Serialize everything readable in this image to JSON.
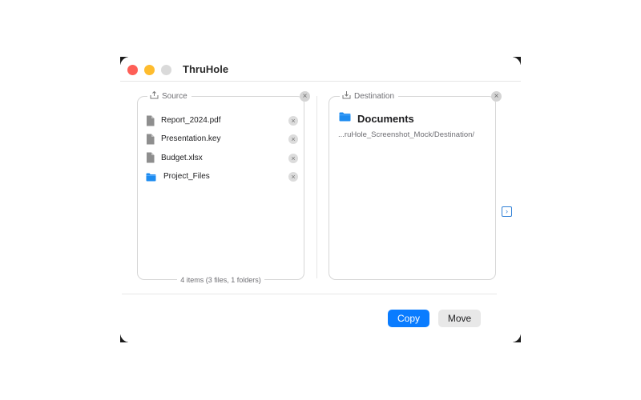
{
  "window": {
    "title": "ThruHole"
  },
  "source": {
    "label": "Source",
    "items": [
      {
        "name": "Report_2024.pdf",
        "kind": "file",
        "icon": "document-icon"
      },
      {
        "name": "Presentation.key",
        "kind": "file",
        "icon": "document-icon"
      },
      {
        "name": "Budget.xlsx",
        "kind": "file",
        "icon": "document-icon"
      },
      {
        "name": "Project_Files",
        "kind": "folder",
        "icon": "folder-icon"
      }
    ],
    "summary": "4 items (3 files, 1 folders)"
  },
  "destination": {
    "label": "Destination",
    "folder_name": "Documents",
    "path": "...ruHole_Screenshot_Mock/Destination/"
  },
  "buttons": {
    "copy": "Copy",
    "move": "Move"
  },
  "colors": {
    "accent": "#0a7cff",
    "folder": "#1e8cf0",
    "close": "#fe5f57",
    "minimize": "#febc2e"
  }
}
